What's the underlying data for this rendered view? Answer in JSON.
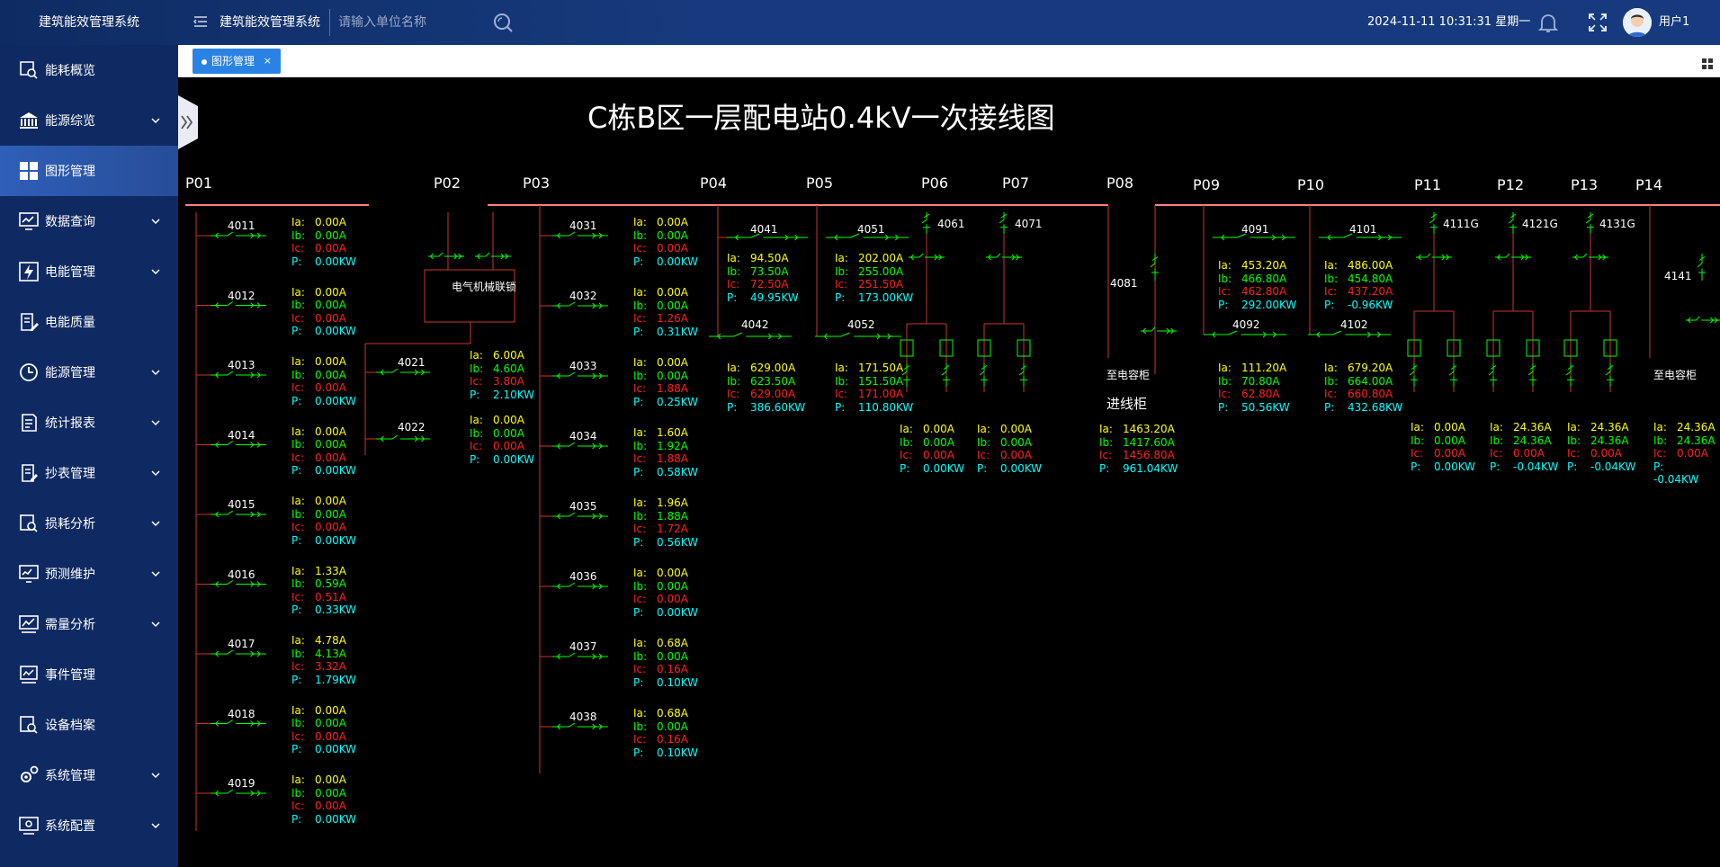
{
  "app": {
    "brand": "建筑能效管理系统",
    "title": "建筑能效管理系统",
    "search_placeholder": "请输入单位名称",
    "datetime": "2024-11-11 10:31:31 星期一",
    "user": "用户1"
  },
  "sidebar": {
    "items": [
      {
        "label": "能耗概览",
        "icon": "chart-search-icon",
        "arrow": false
      },
      {
        "label": "能源综览",
        "icon": "bank-icon",
        "arrow": true
      },
      {
        "label": "图形管理",
        "icon": "grid-icon",
        "arrow": false,
        "active": true
      },
      {
        "label": "数据查询",
        "icon": "monitor-chart-icon",
        "arrow": true
      },
      {
        "label": "电能管理",
        "icon": "lightning-icon",
        "arrow": true
      },
      {
        "label": "电能质量",
        "icon": "document-edit-icon",
        "arrow": false
      },
      {
        "label": "能源管理",
        "icon": "clock-icon",
        "arrow": true
      },
      {
        "label": "统计报表",
        "icon": "report-icon",
        "arrow": true
      },
      {
        "label": "抄表管理",
        "icon": "meter-reading-icon",
        "arrow": true
      },
      {
        "label": "损耗分析",
        "icon": "loss-analysis-icon",
        "arrow": true
      },
      {
        "label": "预测维护",
        "icon": "forecast-icon",
        "arrow": true
      },
      {
        "label": "需量分析",
        "icon": "demand-icon",
        "arrow": true
      },
      {
        "label": "事件管理",
        "icon": "event-icon",
        "arrow": false
      },
      {
        "label": "设备档案",
        "icon": "device-archive-icon",
        "arrow": false
      },
      {
        "label": "系统管理",
        "icon": "gears-icon",
        "arrow": true
      },
      {
        "label": "系统配置",
        "icon": "config-icon",
        "arrow": true
      }
    ]
  },
  "tab": {
    "label": "图形管理",
    "close": "×"
  },
  "diagram": {
    "title": "C栋B区一层配电站0.4kV一次接线图",
    "panels": [
      "P01",
      "P02",
      "P03",
      "P04",
      "P05",
      "P06",
      "P07",
      "P08",
      "P09",
      "P10",
      "P11",
      "P12",
      "P13",
      "P14"
    ],
    "interlock_label": "电气机械联锁",
    "to_cap_label": "至电容柜",
    "incoming_label": "进线柜",
    "feeders": [
      {
        "id": "4011",
        "ia": "0.00A",
        "ib": "0.00A",
        "ic": "0.00A",
        "p": "0.00KW"
      },
      {
        "id": "4012",
        "ia": "0.00A",
        "ib": "0.00A",
        "ic": "0.00A",
        "p": "0.00KW"
      },
      {
        "id": "4013",
        "ia": "0.00A",
        "ib": "0.00A",
        "ic": "0.00A",
        "p": "0.00KW"
      },
      {
        "id": "4014",
        "ia": "0.00A",
        "ib": "0.00A",
        "ic": "0.00A",
        "p": "0.00KW"
      },
      {
        "id": "4015",
        "ia": "0.00A",
        "ib": "0.00A",
        "ic": "0.00A",
        "p": "0.00KW"
      },
      {
        "id": "4016",
        "ia": "1.33A",
        "ib": "0.59A",
        "ic": "0.51A",
        "p": "0.33KW"
      },
      {
        "id": "4017",
        "ia": "4.78A",
        "ib": "4.13A",
        "ic": "3.32A",
        "p": "1.79KW"
      },
      {
        "id": "4018",
        "ia": "0.00A",
        "ib": "0.00A",
        "ic": "0.00A",
        "p": "0.00KW"
      },
      {
        "id": "4019",
        "ia": "0.00A",
        "ib": "0.00A",
        "ic": "0.00A",
        "p": "0.00KW"
      },
      {
        "id": "4021",
        "ia": "6.00A",
        "ib": "4.60A",
        "ic": "3.80A",
        "p": "2.10KW"
      },
      {
        "id": "4022",
        "ia": "0.00A",
        "ib": "0.00A",
        "ic": "0.00A",
        "p": "0.00KW"
      },
      {
        "id": "4031",
        "ia": "0.00A",
        "ib": "0.00A",
        "ic": "0.00A",
        "p": "0.00KW"
      },
      {
        "id": "4032",
        "ia": "0.00A",
        "ib": "0.00A",
        "ic": "1.26A",
        "p": "0.31KW"
      },
      {
        "id": "4033",
        "ia": "0.00A",
        "ib": "0.00A",
        "ic": "1.88A",
        "p": "0.25KW"
      },
      {
        "id": "4034",
        "ia": "1.60A",
        "ib": "1.92A",
        "ic": "1.88A",
        "p": "0.58KW"
      },
      {
        "id": "4035",
        "ia": "1.96A",
        "ib": "1.88A",
        "ic": "1.72A",
        "p": "0.56KW"
      },
      {
        "id": "4036",
        "ia": "0.00A",
        "ib": "0.00A",
        "ic": "0.00A",
        "p": "0.00KW"
      },
      {
        "id": "4037",
        "ia": "0.68A",
        "ib": "0.00A",
        "ic": "0.16A",
        "p": "0.10KW"
      },
      {
        "id": "4038",
        "ia": "0.68A",
        "ib": "0.00A",
        "ic": "0.16A",
        "p": "0.10KW"
      },
      {
        "id": "4041",
        "ia": "94.50A",
        "ib": "73.50A",
        "ic": "72.50A",
        "p": "49.95KW"
      },
      {
        "id": "4042",
        "ia": "629.00A",
        "ib": "623.50A",
        "ic": "629.00A",
        "p": "386.60KW"
      },
      {
        "id": "4051",
        "ia": "202.00A",
        "ib": "255.00A",
        "ic": "251.50A",
        "p": "173.00KW"
      },
      {
        "id": "4052",
        "ia": "171.50A",
        "ib": "151.50A",
        "ic": "171.00A",
        "p": "110.80KW"
      },
      {
        "id": "4061",
        "ia": "0.00A",
        "ib": "0.00A",
        "ic": "0.00A",
        "p": "0.00KW"
      },
      {
        "id": "4071",
        "ia": "0.00A",
        "ib": "0.00A",
        "ic": "0.00A",
        "p": "0.00KW"
      },
      {
        "id": "4081",
        "ia": "1463.20A",
        "ib": "1417.60A",
        "ic": "1456.80A",
        "p": "961.04KW"
      },
      {
        "id": "4091",
        "ia": "453.20A",
        "ib": "466.80A",
        "ic": "462.80A",
        "p": "292.00KW"
      },
      {
        "id": "4092",
        "ia": "111.20A",
        "ib": "70.80A",
        "ic": "62.80A",
        "p": "50.56KW"
      },
      {
        "id": "4101",
        "ia": "486.00A",
        "ib": "454.80A",
        "ic": "437.20A",
        "p": "-0.96KW"
      },
      {
        "id": "4102",
        "ia": "679.20A",
        "ib": "664.00A",
        "ic": "660.80A",
        "p": "432.68KW"
      },
      {
        "id": "4111G",
        "ia": "0.00A",
        "ib": "0.00A",
        "ic": "0.00A",
        "p": "0.00KW"
      },
      {
        "id": "4121G",
        "ia": "24.36A",
        "ib": "24.36A",
        "ic": "0.00A",
        "p": "-0.04KW"
      },
      {
        "id": "4131G",
        "ia": "24.36A",
        "ib": "24.36A",
        "ic": "0.00A",
        "p": "-0.04KW"
      },
      {
        "id": "4141",
        "ia": "24.36A",
        "ib": "24.36A",
        "ic": "0.00A",
        "p": "-0.04KW"
      }
    ]
  },
  "colors": {
    "ia": "#ffff00",
    "ib": "#00ff00",
    "ic": "#ff2020",
    "p": "#00ffff",
    "bus": "#ff8080",
    "wire": "#cc3333",
    "switch": "#00ff00"
  }
}
